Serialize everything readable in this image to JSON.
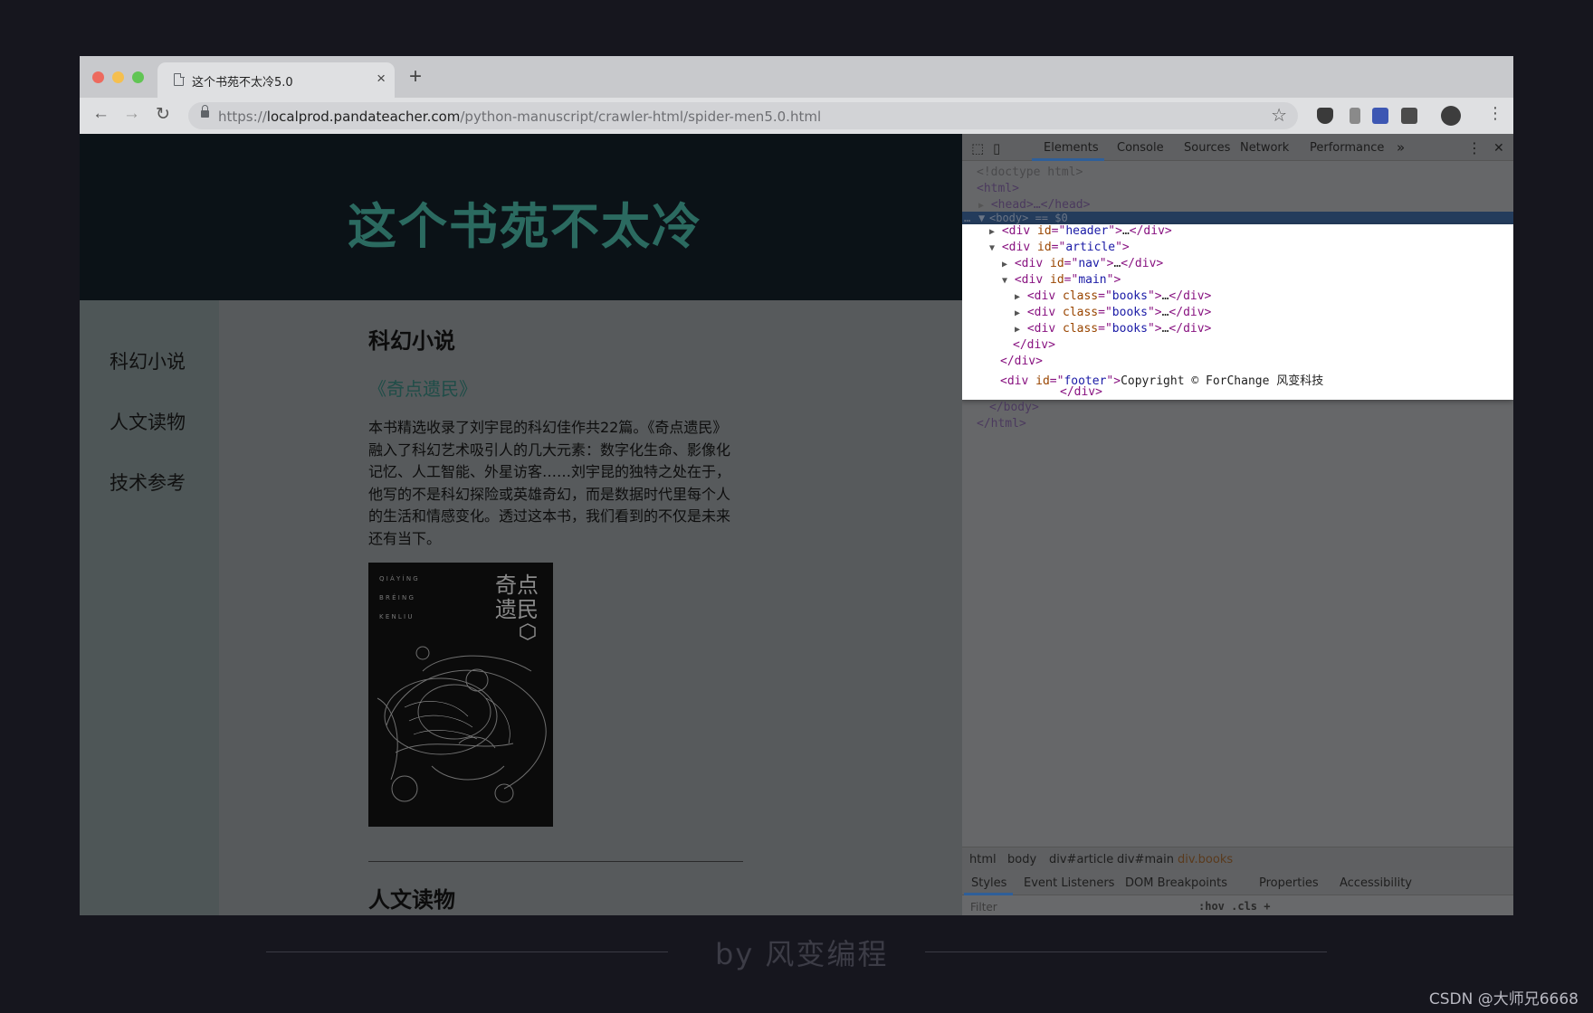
{
  "browser": {
    "tab_title": "这个书苑不太冷5.0",
    "tab_close": "×",
    "new_tab": "+",
    "url_scheme": "https://",
    "url_host": "localprod.pandateacher.com",
    "url_path": "/python-manuscript/crawler-html/spider-men5.0.html",
    "back": "←",
    "forward": "→",
    "reload": "↻",
    "star": "☆",
    "menu": "⋮"
  },
  "page": {
    "site_title": "这个书苑不太冷",
    "nav": [
      "科幻小说",
      "人文读物",
      "技术参考"
    ],
    "section1_title": "科幻小说",
    "book_title": "《奇点遗民》",
    "book_desc": "本书精选收录了刘宇昆的科幻佳作共22篇。《奇点遗民》融入了科幻艺术吸引人的几大元素：数字化生命、影像化记忆、人工智能、外星访客……刘宇昆的独特之处在于，他写的不是科幻探险或英雄奇幻，而是数据时代里每个人的生活和情感变化。透过这本书，我们看到的不仅是未来还有当下。",
    "cover_title_line1": "奇点",
    "cover_title_line2": "遗民",
    "cover_pinyin_1": "Q I Á Y Í N G",
    "cover_pinyin_2": "B R É I N G",
    "cover_pinyin_3": "K E N   L I U",
    "section2_title": "人文读物"
  },
  "devtools": {
    "tabs": [
      "Elements",
      "Console",
      "Sources",
      "Network",
      "Performance"
    ],
    "more": "»",
    "close": "✕",
    "kebab": "⋮",
    "lines": {
      "doctype": "<!doctype html>",
      "html_open": "<html>",
      "head": "<head>…</head>",
      "body": "<body> == $0",
      "body_prefix": "…",
      "html_close": "</html>",
      "body_close": "</body>"
    },
    "tree": {
      "header_id": "header",
      "article_id": "article",
      "nav_id": "nav",
      "main_id": "main",
      "books_class": "books",
      "footer_id": "footer",
      "footer_text": "Copyright © ForChange 风变科技"
    },
    "breadcrumbs": [
      "html",
      "body",
      "div#article",
      "div#main",
      "div.books"
    ],
    "sub_tabs": [
      "Styles",
      "Event Listeners",
      "DOM Breakpoints",
      "Properties",
      "Accessibility"
    ],
    "filter_placeholder": "Filter",
    "filter_opts": ":hov  .cls  +"
  },
  "footer": {
    "text": "by 风变编程",
    "watermark": "CSDN @大师兄6668"
  }
}
